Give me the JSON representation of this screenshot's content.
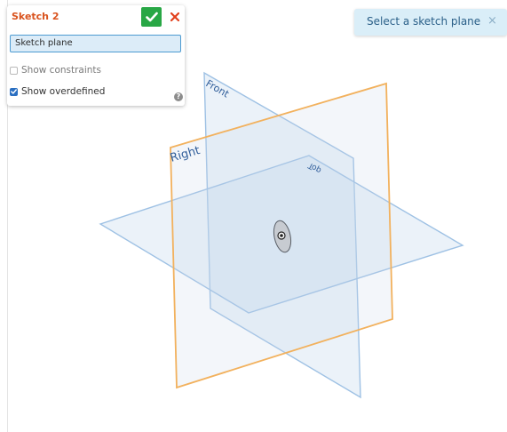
{
  "dialog": {
    "title": "Sketch 2",
    "confirm_icon": "checkmark-icon",
    "cancel_icon": "close-x-icon",
    "sketch_plane_placeholder": "Sketch plane",
    "show_constraints_label": "Show constraints",
    "show_constraints_checked": false,
    "show_overdefined_label": "Show overdefined",
    "show_overdefined_checked": true,
    "help_glyph": "?"
  },
  "toast": {
    "message": "Select a sketch plane",
    "close_glyph": "×"
  },
  "planes": {
    "front_label": "Front",
    "right_label": "Right",
    "top_label": "Top"
  },
  "colors": {
    "title_orange": "#d9531e",
    "confirm_green": "#28a745",
    "cancel_red": "#e2401c",
    "highlight_plane_orange": "#f2b15d",
    "plane_blue": "#9ec1e4",
    "toast_background": "#daeef8"
  }
}
